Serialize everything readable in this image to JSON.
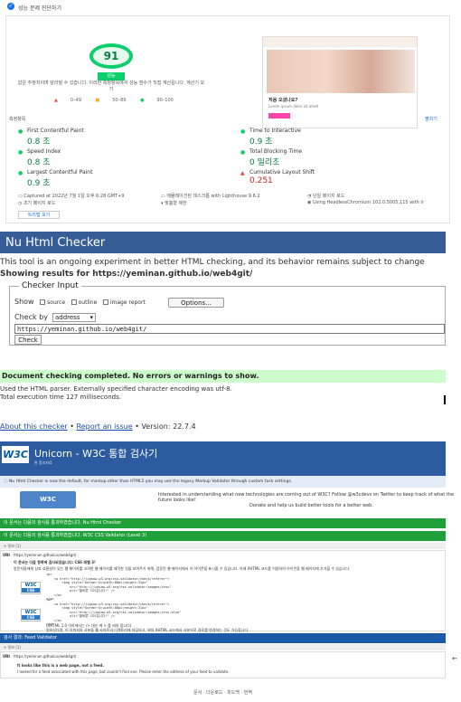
{
  "lighthouse": {
    "header": "성능 문제 진단하기",
    "score": "91",
    "score_label": "성능",
    "description": "값은 추정치이며 달라질 수 있습니다. 이러한 측정항목에서 성능 점수가 직접 계산됩니다. 계산기 보기",
    "legend": [
      "0–49",
      "50–89",
      "90–100"
    ],
    "metrics_header": "측정항목",
    "expand_view": "펼치기",
    "metrics": [
      {
        "name": "First Contentful Paint",
        "value": "0.8 초",
        "status": "good"
      },
      {
        "name": "Time to Interactive",
        "value": "0.9 초",
        "status": "good"
      },
      {
        "name": "Speed Index",
        "value": "0.8 초",
        "status": "good"
      },
      {
        "name": "Total Blocking Time",
        "value": "0 밀리초",
        "status": "good"
      },
      {
        "name": "Largest Contentful Paint",
        "value": "0.9 초",
        "status": "good"
      },
      {
        "name": "Cumulative Layout Shift",
        "value": "0.251",
        "status": "poor"
      }
    ],
    "env": [
      "Captured at 2022년 7월 1일 오후 6:28 GMT+9",
      "에뮬레이션된 데스크톱 with Lighthouse 9.6.2",
      "단일 페이지 로드",
      "초기 페이지 로드",
      "맞춤형 제한",
      "Using HeadlessChromium 102.0.5005.115 with lr"
    ],
    "treemap_button": "트리맵 보기",
    "preview": {
      "heading": "처음 오셨나요?",
      "text": "Lorem ipsum dolor sit amet"
    }
  },
  "nu": {
    "title": "Nu Html Checker",
    "notice": "This tool is an ongoing experiment in better HTML checking, and its behavior remains subject to change",
    "results_for": "Showing results for https://yeminan.github.io/web4git/",
    "fieldset_legend": "Checker Input",
    "show_label": "Show",
    "show_options": [
      "source",
      "outline",
      "image report"
    ],
    "options_button": "Options...",
    "check_by_label": "Check by",
    "check_by_value": "address",
    "url_value": "https://yeminan.github.io/web4git/",
    "check_button": "Check",
    "success_message": "Document checking completed. No errors or warnings to show.",
    "parser_note": "Used the HTML parser. Externally specified character encoding was utf-8.",
    "exec_time": "Total execution time 127 milliseconds.",
    "footer": {
      "about": "About this checker",
      "sep": "•",
      "report": "Report an issue",
      "version": "• Version: 22.7.4"
    }
  },
  "unicorn": {
    "logo": "W3C",
    "title": "Unicorn - W3C 통합 검사기",
    "subtitle": "한 참조자료",
    "info": "Nu Html Checker is now the default, for markup other than HTML5 you may use the legacy Markup Validator through custom task settings.",
    "dev_logo": "W3C DEVELOPERS",
    "promo_1": "Interested in understanding what new technologies are coming out of W3C? Follow @w3cdevs on Twitter to keep track of what the future looks like!",
    "promo_2": "Donate and help us build better tools for a better web.",
    "results": [
      "이 문서는 다음의 검사를 통과하였습니다.  Nu Html Checker",
      "이 문서는 다음의 검사를 통과하였습니다.  W3C CSS Validator (Level 3)"
    ],
    "info_label": "+ 정보 (1)",
    "uri_label": "URI",
    "uri_value": "https://yeminan.github.io/web4git/",
    "css_pass": "이 문서는 다음 항목에 검사되었습니다: CSS 레벨 3!",
    "css_desc": "방문자들에게 상호 호환성이 있는 웹 페이지를 고려한 웹 페이지를 제작한 것을 보여주기 위해, 검증된 웹 페이지에서 이 아이콘을 표시할 수 있습니다. 아래 XHTML 코드를 이용하여 아이콘을 웹 페이지에 추가할 수 있습니다.",
    "code_1": "<p>\n    <a href=\"http://jigsaw.w3.org/css-validator/check/referer\">\n        <img style=\"border:0;width:88px;height:31px\"\n            src=\"http://jigsaw.w3.org/css-validator/images/vcss\"\n            alt=\"올바른 CSS입니다!\" />\n    </a>\n</p>",
    "code_2": "<p>\n    <a href=\"http://jigsaw.w3.org/css-validator/check/referer\">\n        <img style=\"border:0;width:88px;height:31px\"\n            src=\"http://jigsaw.w3.org/css-validator/images/vcss-blue\"\n            alt=\"올바른 CSS입니다!\" />\n    </a>\n</p>",
    "badge_css": "CSS",
    "css_foot": "(XHTML 1.0 이하에서는 /> 대신 에 > 를 써야 합니다)\n원하신다면, 이 이미지의 사본을 웹 사이트의 디렉토리에 저장하고, 위의 XHTML 코드에서 사본으로 경로를 변경하는 것도 가능합니다.",
    "feed_bar": "검사 결과: Feed Validator",
    "feed_info": "+ 정보 (1)",
    "feed_uri": "https://yeminan.github.io/web4git/",
    "feed_msg_1": "It looks like this is a web page, not a feed.",
    "feed_msg_2": "I looked for a feed associated with this page, but couldn't find one. Please enter the address of your feed to validate.",
    "footer": "문서 · 다운로드 · 피드백 · 번역"
  },
  "colors": {
    "nu_bar": "#365d95",
    "unicorn_bar": "#2d5ba0",
    "pass_green": "#1fa03a",
    "lh_good": "#0cce6b",
    "lh_poor": "#e8453c"
  }
}
